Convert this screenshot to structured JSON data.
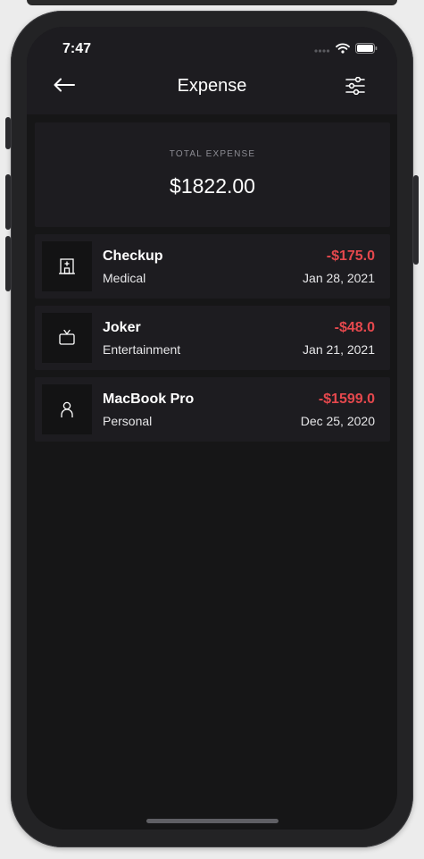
{
  "status_bar": {
    "time": "7:47",
    "icons": [
      "cellular-signal-icon",
      "wifi-icon",
      "battery-icon"
    ]
  },
  "header": {
    "title": "Expense",
    "back_icon": "arrow-left-icon",
    "filter_icon": "sliders-icon"
  },
  "summary": {
    "label": "TOTAL EXPENSE",
    "amount": "$1822.00"
  },
  "transactions": [
    {
      "title": "Checkup",
      "category": "Medical",
      "amount": "-$175.0",
      "date": "Jan 28, 2021",
      "icon": "hospital-icon"
    },
    {
      "title": "Joker",
      "category": "Entertainment",
      "amount": "-$48.0",
      "date": "Jan 21, 2021",
      "icon": "tv-icon"
    },
    {
      "title": "MacBook Pro",
      "category": "Personal",
      "amount": "-$1599.0",
      "date": "Dec 25, 2020",
      "icon": "user-icon"
    }
  ],
  "colors": {
    "background": "#161617",
    "card": "#1d1c20",
    "icon_box": "#131314",
    "negative_amount": "#e5484d",
    "text_primary": "#ffffff",
    "text_muted": "#8c8c93"
  }
}
